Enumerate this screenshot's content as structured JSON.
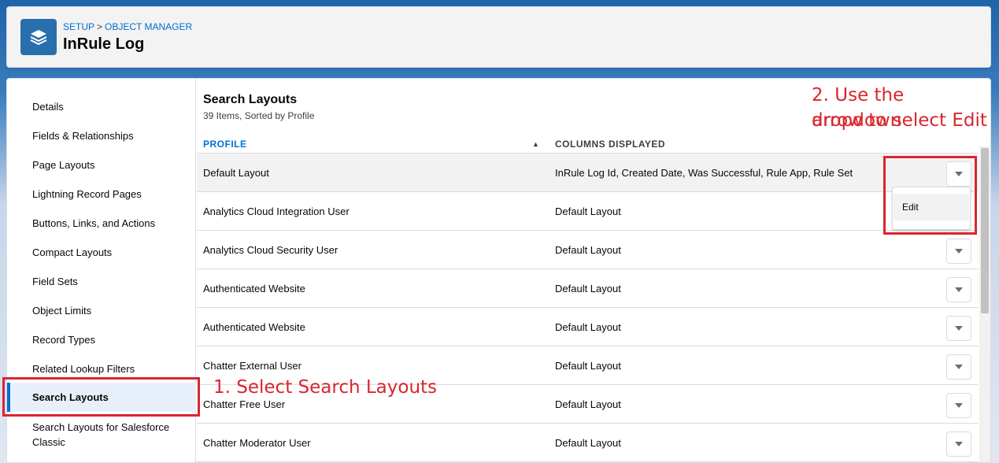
{
  "header": {
    "breadcrumb": [
      "SETUP",
      "OBJECT MANAGER"
    ],
    "breadcrumb_separator": ">",
    "title": "InRule Log",
    "icon": "layers-icon"
  },
  "sidebar": {
    "items": [
      {
        "label": "Details"
      },
      {
        "label": "Fields & Relationships"
      },
      {
        "label": "Page Layouts"
      },
      {
        "label": "Lightning Record Pages"
      },
      {
        "label": "Buttons, Links, and Actions"
      },
      {
        "label": "Compact Layouts"
      },
      {
        "label": "Field Sets"
      },
      {
        "label": "Object Limits"
      },
      {
        "label": "Record Types"
      },
      {
        "label": "Related Lookup Filters"
      },
      {
        "label": "Search Layouts",
        "active": true
      },
      {
        "label": "Search Layouts for Salesforce Classic"
      }
    ]
  },
  "main": {
    "title": "Search Layouts",
    "subtitle": "39 Items, Sorted by Profile",
    "columns": {
      "profile": "PROFILE",
      "columns_displayed": "COLUMNS DISPLAYED"
    },
    "sort_indicator": "▲",
    "rows": [
      {
        "profile": "Default Layout",
        "columns": "InRule Log Id, Created Date, Was Successful, Rule App, Rule Set"
      },
      {
        "profile": "Analytics Cloud Integration User",
        "columns": "Default Layout"
      },
      {
        "profile": "Analytics Cloud Security User",
        "columns": "Default Layout"
      },
      {
        "profile": "Authenticated Website",
        "columns": "Default Layout"
      },
      {
        "profile": "Authenticated Website",
        "columns": "Default Layout"
      },
      {
        "profile": "Chatter External User",
        "columns": "Default Layout"
      },
      {
        "profile": "Chatter Free User",
        "columns": "Default Layout"
      },
      {
        "profile": "Chatter Moderator User",
        "columns": "Default Layout"
      }
    ],
    "row_menu": {
      "items": [
        "Edit"
      ]
    }
  },
  "annotations": {
    "step1": "1. Select Search Layouts",
    "step2_line1": "2. Use the dropdown",
    "step2_line2": "arrow to select Edit",
    "color": "#d9262e"
  }
}
